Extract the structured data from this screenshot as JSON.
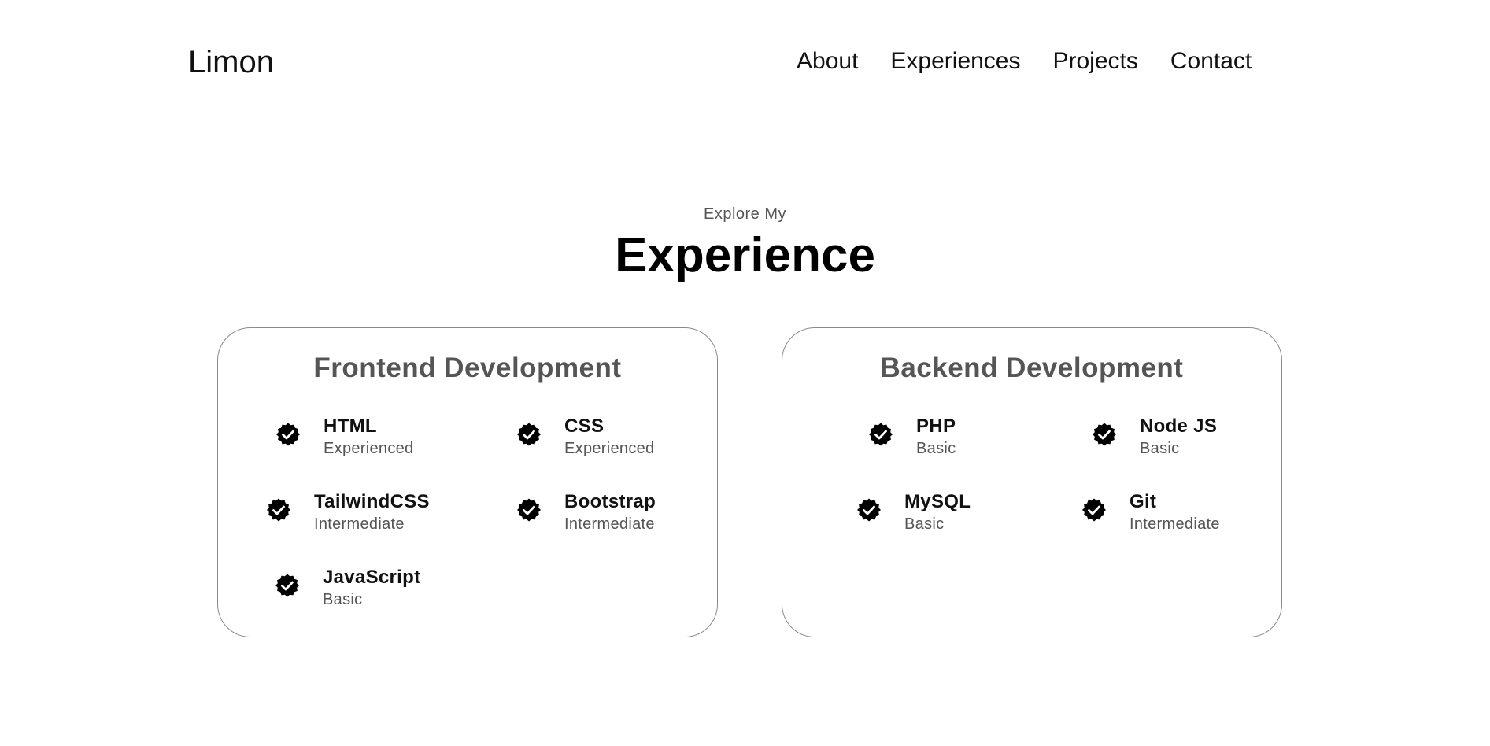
{
  "nav": {
    "logo": "Limon",
    "links": [
      "About",
      "Experiences",
      "Projects",
      "Contact"
    ]
  },
  "section": {
    "subtitle": "Explore My",
    "title": "Experience"
  },
  "cards": [
    {
      "title": "Frontend Development",
      "skills": [
        {
          "name": "HTML",
          "level": "Experienced"
        },
        {
          "name": "CSS",
          "level": "Experienced"
        },
        {
          "name": "TailwindCSS",
          "level": "Intermediate"
        },
        {
          "name": "Bootstrap",
          "level": "Intermediate"
        },
        {
          "name": "JavaScript",
          "level": "Basic"
        }
      ]
    },
    {
      "title": "Backend Development",
      "skills": [
        {
          "name": "PHP",
          "level": "Basic"
        },
        {
          "name": "Node JS",
          "level": "Basic"
        },
        {
          "name": "MySQL",
          "level": "Basic"
        },
        {
          "name": "Git",
          "level": "Intermediate"
        }
      ]
    }
  ],
  "icons": {
    "skill_badge": "verified-check-icon"
  }
}
